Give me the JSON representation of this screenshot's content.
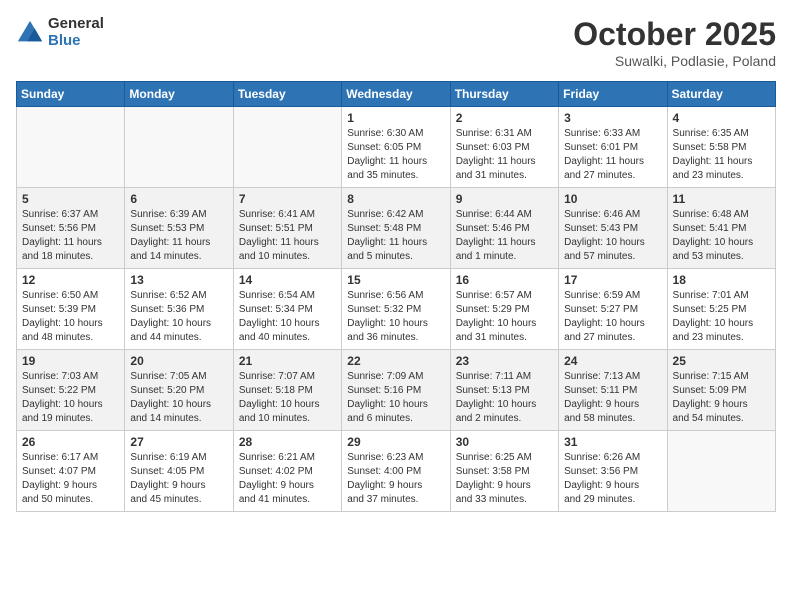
{
  "header": {
    "logo_general": "General",
    "logo_blue": "Blue",
    "month": "October 2025",
    "location": "Suwalki, Podlasie, Poland"
  },
  "days_of_week": [
    "Sunday",
    "Monday",
    "Tuesday",
    "Wednesday",
    "Thursday",
    "Friday",
    "Saturday"
  ],
  "weeks": [
    [
      {
        "day": "",
        "info": ""
      },
      {
        "day": "",
        "info": ""
      },
      {
        "day": "",
        "info": ""
      },
      {
        "day": "1",
        "info": "Sunrise: 6:30 AM\nSunset: 6:05 PM\nDaylight: 11 hours\nand 35 minutes."
      },
      {
        "day": "2",
        "info": "Sunrise: 6:31 AM\nSunset: 6:03 PM\nDaylight: 11 hours\nand 31 minutes."
      },
      {
        "day": "3",
        "info": "Sunrise: 6:33 AM\nSunset: 6:01 PM\nDaylight: 11 hours\nand 27 minutes."
      },
      {
        "day": "4",
        "info": "Sunrise: 6:35 AM\nSunset: 5:58 PM\nDaylight: 11 hours\nand 23 minutes."
      }
    ],
    [
      {
        "day": "5",
        "info": "Sunrise: 6:37 AM\nSunset: 5:56 PM\nDaylight: 11 hours\nand 18 minutes."
      },
      {
        "day": "6",
        "info": "Sunrise: 6:39 AM\nSunset: 5:53 PM\nDaylight: 11 hours\nand 14 minutes."
      },
      {
        "day": "7",
        "info": "Sunrise: 6:41 AM\nSunset: 5:51 PM\nDaylight: 11 hours\nand 10 minutes."
      },
      {
        "day": "8",
        "info": "Sunrise: 6:42 AM\nSunset: 5:48 PM\nDaylight: 11 hours\nand 5 minutes."
      },
      {
        "day": "9",
        "info": "Sunrise: 6:44 AM\nSunset: 5:46 PM\nDaylight: 11 hours\nand 1 minute."
      },
      {
        "day": "10",
        "info": "Sunrise: 6:46 AM\nSunset: 5:43 PM\nDaylight: 10 hours\nand 57 minutes."
      },
      {
        "day": "11",
        "info": "Sunrise: 6:48 AM\nSunset: 5:41 PM\nDaylight: 10 hours\nand 53 minutes."
      }
    ],
    [
      {
        "day": "12",
        "info": "Sunrise: 6:50 AM\nSunset: 5:39 PM\nDaylight: 10 hours\nand 48 minutes."
      },
      {
        "day": "13",
        "info": "Sunrise: 6:52 AM\nSunset: 5:36 PM\nDaylight: 10 hours\nand 44 minutes."
      },
      {
        "day": "14",
        "info": "Sunrise: 6:54 AM\nSunset: 5:34 PM\nDaylight: 10 hours\nand 40 minutes."
      },
      {
        "day": "15",
        "info": "Sunrise: 6:56 AM\nSunset: 5:32 PM\nDaylight: 10 hours\nand 36 minutes."
      },
      {
        "day": "16",
        "info": "Sunrise: 6:57 AM\nSunset: 5:29 PM\nDaylight: 10 hours\nand 31 minutes."
      },
      {
        "day": "17",
        "info": "Sunrise: 6:59 AM\nSunset: 5:27 PM\nDaylight: 10 hours\nand 27 minutes."
      },
      {
        "day": "18",
        "info": "Sunrise: 7:01 AM\nSunset: 5:25 PM\nDaylight: 10 hours\nand 23 minutes."
      }
    ],
    [
      {
        "day": "19",
        "info": "Sunrise: 7:03 AM\nSunset: 5:22 PM\nDaylight: 10 hours\nand 19 minutes."
      },
      {
        "day": "20",
        "info": "Sunrise: 7:05 AM\nSunset: 5:20 PM\nDaylight: 10 hours\nand 14 minutes."
      },
      {
        "day": "21",
        "info": "Sunrise: 7:07 AM\nSunset: 5:18 PM\nDaylight: 10 hours\nand 10 minutes."
      },
      {
        "day": "22",
        "info": "Sunrise: 7:09 AM\nSunset: 5:16 PM\nDaylight: 10 hours\nand 6 minutes."
      },
      {
        "day": "23",
        "info": "Sunrise: 7:11 AM\nSunset: 5:13 PM\nDaylight: 10 hours\nand 2 minutes."
      },
      {
        "day": "24",
        "info": "Sunrise: 7:13 AM\nSunset: 5:11 PM\nDaylight: 9 hours\nand 58 minutes."
      },
      {
        "day": "25",
        "info": "Sunrise: 7:15 AM\nSunset: 5:09 PM\nDaylight: 9 hours\nand 54 minutes."
      }
    ],
    [
      {
        "day": "26",
        "info": "Sunrise: 6:17 AM\nSunset: 4:07 PM\nDaylight: 9 hours\nand 50 minutes."
      },
      {
        "day": "27",
        "info": "Sunrise: 6:19 AM\nSunset: 4:05 PM\nDaylight: 9 hours\nand 45 minutes."
      },
      {
        "day": "28",
        "info": "Sunrise: 6:21 AM\nSunset: 4:02 PM\nDaylight: 9 hours\nand 41 minutes."
      },
      {
        "day": "29",
        "info": "Sunrise: 6:23 AM\nSunset: 4:00 PM\nDaylight: 9 hours\nand 37 minutes."
      },
      {
        "day": "30",
        "info": "Sunrise: 6:25 AM\nSunset: 3:58 PM\nDaylight: 9 hours\nand 33 minutes."
      },
      {
        "day": "31",
        "info": "Sunrise: 6:26 AM\nSunset: 3:56 PM\nDaylight: 9 hours\nand 29 minutes."
      },
      {
        "day": "",
        "info": ""
      }
    ]
  ]
}
